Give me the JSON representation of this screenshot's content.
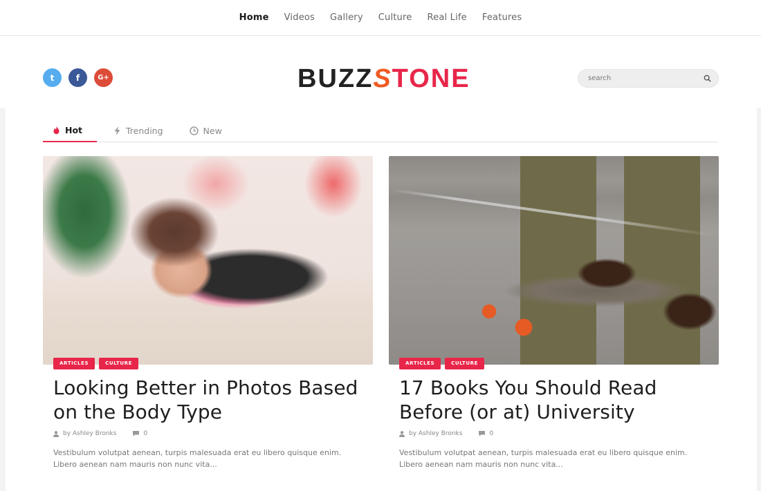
{
  "topnav": {
    "items": [
      {
        "label": "Home",
        "active": true
      },
      {
        "label": "Videos"
      },
      {
        "label": "Gallery"
      },
      {
        "label": "Culture"
      },
      {
        "label": "Real Life"
      },
      {
        "label": "Features"
      }
    ]
  },
  "header": {
    "logo": {
      "part1": "BUZZ",
      "part2": "S",
      "part3": "TONE"
    },
    "socials": [
      {
        "name": "twitter",
        "glyph": "t",
        "color": "#55acee"
      },
      {
        "name": "facebook",
        "glyph": "f",
        "color": "#3b5998"
      },
      {
        "name": "google-plus",
        "glyph": "G+",
        "color": "#dd4b39"
      }
    ],
    "search": {
      "placeholder": "search",
      "value": ""
    }
  },
  "tabs": [
    {
      "label": "Hot",
      "icon": "flame-icon",
      "active": true
    },
    {
      "label": "Trending",
      "icon": "bolt-icon"
    },
    {
      "label": "New",
      "icon": "clock-icon"
    }
  ],
  "posts": [
    {
      "tags": [
        "ARTICLES",
        "CULTURE"
      ],
      "title": "Looking Better in Photos Based on the Body Type",
      "author": "by Ashley Bronks",
      "comments": "0",
      "excerpt": "Vestibulum volutpat aenean, turpis malesuada erat eu libero quisque enim. Libero aenean nam mauris non nunc vita..."
    },
    {
      "tags": [
        "ARTICLES",
        "CULTURE"
      ],
      "title": "17 Books You Should Read Before (or at) University",
      "author": "by Ashley Bronks",
      "comments": "0",
      "excerpt": "Vestibulum volutpat aenean, turpis malesuada erat eu libero quisque enim. Libero aenean nam mauris non nunc vita..."
    }
  ],
  "colors": {
    "accent": "#e8264a",
    "logo_s": "#f05a22"
  }
}
